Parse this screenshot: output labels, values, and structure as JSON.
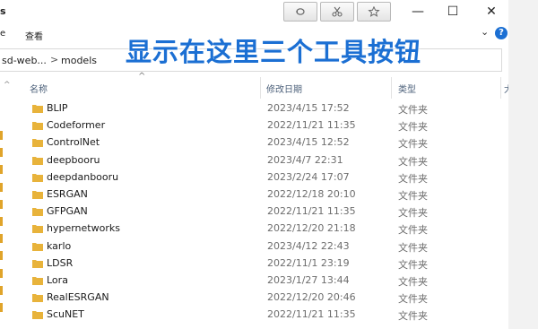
{
  "window": {
    "title": "s",
    "min_symbol": "—",
    "max_symbol": "☐",
    "close_symbol": "✕"
  },
  "toolbar": {
    "buttons": [
      {
        "name": "reload-tool-button",
        "icon": "refresh-icon"
      },
      {
        "name": "scissors-tool-button",
        "icon": "scissors-icon"
      },
      {
        "name": "star-tool-button",
        "icon": "star-icon"
      }
    ]
  },
  "ribbon": {
    "left_fragment": "e",
    "view_label": "查看"
  },
  "address": {
    "crumb_1": "sd-web...",
    "separator": ">",
    "crumb_2": "models"
  },
  "annotation": {
    "text": "显示在这里三个工具按钮",
    "color": "#1b6fd3"
  },
  "columns": {
    "name": "名称",
    "date": "修改日期",
    "type": "类型",
    "extra": "大"
  },
  "files": [
    {
      "name": "BLIP",
      "date": "2023/4/15 17:52",
      "type": "文件夹"
    },
    {
      "name": "Codeformer",
      "date": "2022/11/21 11:35",
      "type": "文件夹"
    },
    {
      "name": "ControlNet",
      "date": "2023/4/15 12:52",
      "type": "文件夹"
    },
    {
      "name": "deepbooru",
      "date": "2023/4/7 22:31",
      "type": "文件夹"
    },
    {
      "name": "deepdanbooru",
      "date": "2023/2/24 17:07",
      "type": "文件夹"
    },
    {
      "name": "ESRGAN",
      "date": "2022/12/18 20:10",
      "type": "文件夹"
    },
    {
      "name": "GFPGAN",
      "date": "2022/11/21 11:35",
      "type": "文件夹"
    },
    {
      "name": "hypernetworks",
      "date": "2022/12/20 21:18",
      "type": "文件夹"
    },
    {
      "name": "karlo",
      "date": "2023/4/12 22:43",
      "type": "文件夹"
    },
    {
      "name": "LDSR",
      "date": "2022/11/1 23:19",
      "type": "文件夹"
    },
    {
      "name": "Lora",
      "date": "2023/1/27 13:44",
      "type": "文件夹"
    },
    {
      "name": "RealESRGAN",
      "date": "2022/12/20 20:46",
      "type": "文件夹"
    },
    {
      "name": "ScuNET",
      "date": "2022/11/21 11:35",
      "type": "文件夹"
    }
  ],
  "folder_color": "#e8b33b"
}
